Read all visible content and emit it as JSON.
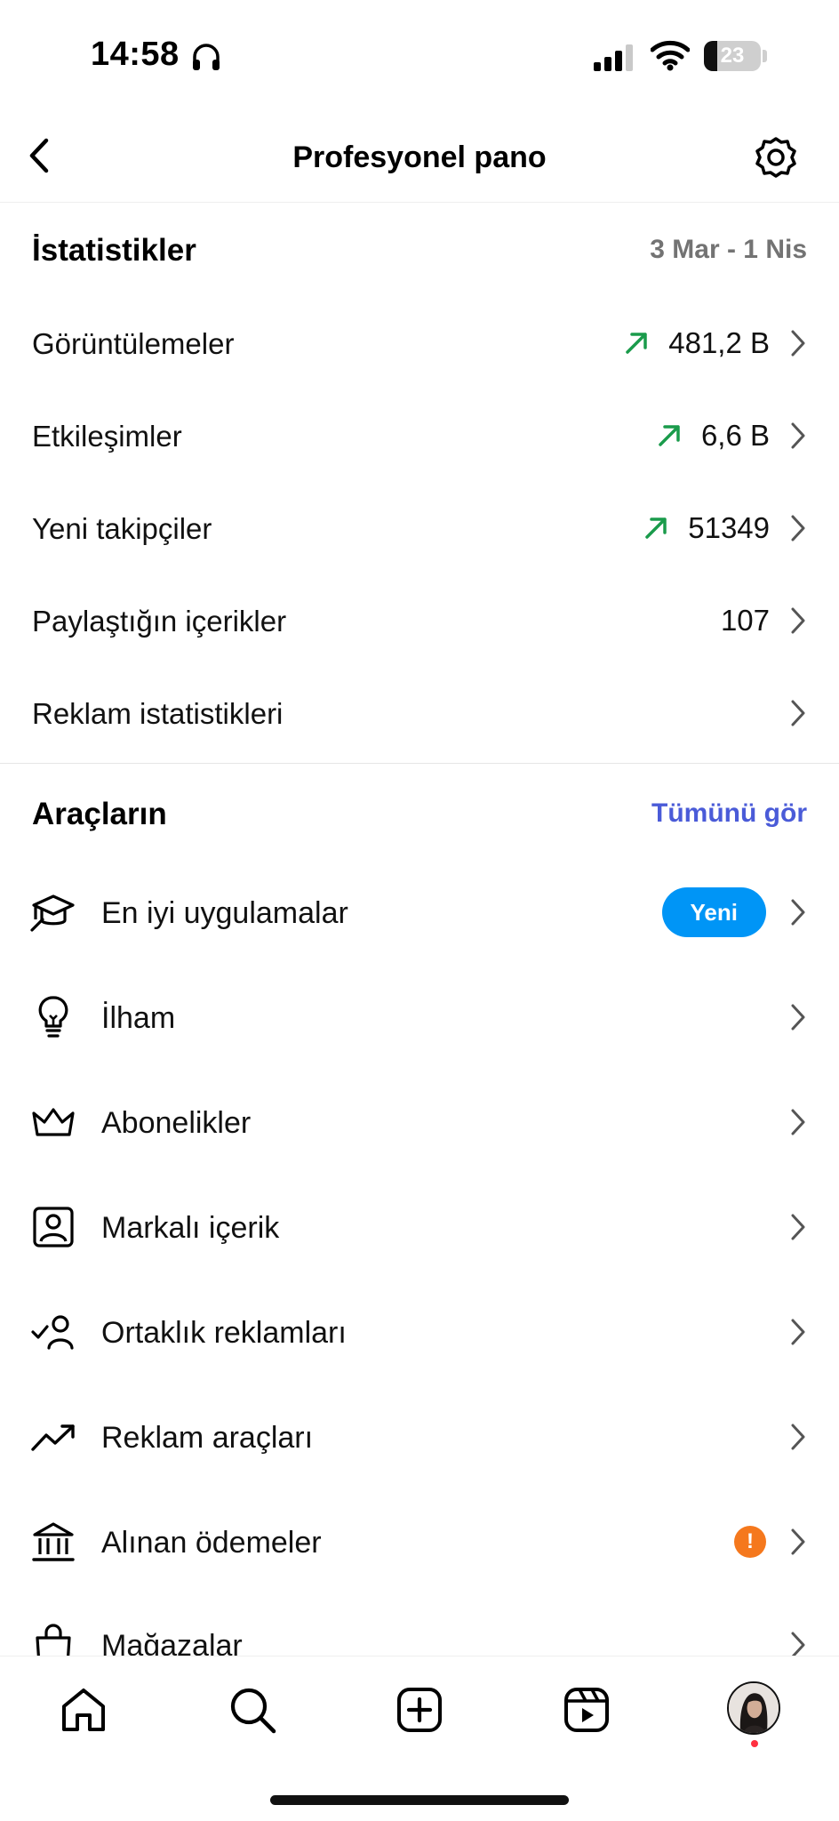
{
  "status_bar": {
    "time": "14:58",
    "battery": "23",
    "battery_level": 0.23
  },
  "header": {
    "title": "Profesyonel pano"
  },
  "stats": {
    "title": "İstatistikler",
    "date_range": "3 Mar - 1 Nis",
    "rows": [
      {
        "label": "Görüntülemeler",
        "value": "481,2 B",
        "trend": "up"
      },
      {
        "label": "Etkileşimler",
        "value": "6,6 B",
        "trend": "up"
      },
      {
        "label": "Yeni takipçiler",
        "value": "51349",
        "trend": "up"
      },
      {
        "label": "Paylaştığın içerikler",
        "value": "107",
        "trend": ""
      },
      {
        "label": "Reklam istatistikleri",
        "value": "",
        "trend": ""
      }
    ]
  },
  "tools": {
    "title": "Araçların",
    "see_all": "Tümünü gör",
    "items": [
      {
        "label": "En iyi uygulamalar",
        "icon": "graduation-cap-icon",
        "badge": "Yeni"
      },
      {
        "label": "İlham",
        "icon": "lightbulb-icon"
      },
      {
        "label": "Abonelikler",
        "icon": "crown-icon"
      },
      {
        "label": "Markalı içerik",
        "icon": "branded-content-icon"
      },
      {
        "label": "Ortaklık reklamları",
        "icon": "partnership-icon"
      },
      {
        "label": "Reklam araçları",
        "icon": "trending-up-icon"
      },
      {
        "label": "Alınan ödemeler",
        "icon": "bank-icon",
        "alert": "!"
      },
      {
        "label": "Mağazalar",
        "icon": "shopping-bag-icon"
      }
    ]
  },
  "colors": {
    "trend_up": "#1a9b4b",
    "link": "#4a5bd8",
    "badge": "#0095f6",
    "alert": "#f5781d"
  },
  "bottom_nav": [
    "home-icon",
    "search-icon",
    "create-icon",
    "reels-icon",
    "profile-avatar"
  ]
}
